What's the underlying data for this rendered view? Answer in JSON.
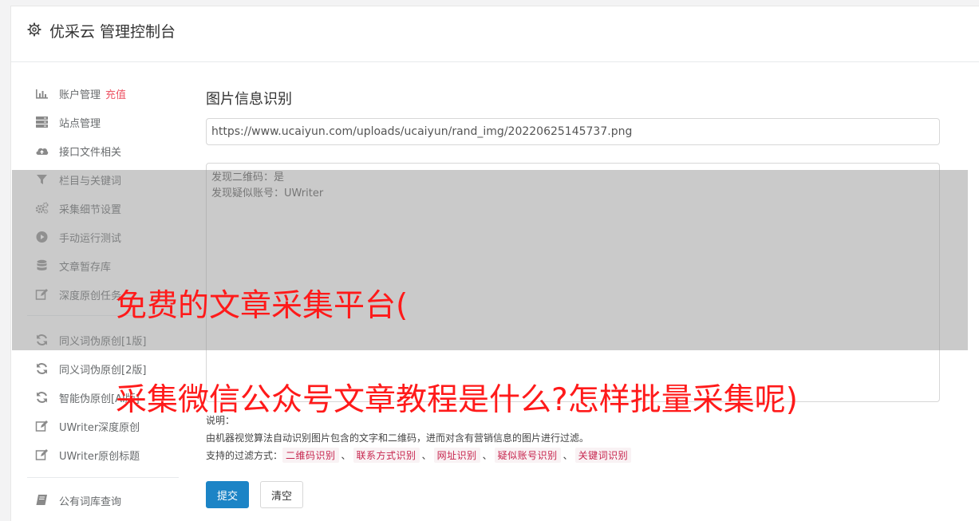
{
  "header": {
    "title": "优采云 管理控制台",
    "icon": "gear-icon"
  },
  "sidebar": {
    "items": [
      {
        "label": "账户管理",
        "extra": "充值",
        "icon": "bar-chart-icon"
      },
      {
        "label": "站点管理",
        "icon": "server-icon"
      },
      {
        "label": "接口文件相关",
        "icon": "cloud-upload-icon"
      },
      {
        "label": "栏目与关键词",
        "icon": "filter-icon"
      },
      {
        "label": "采集细节设置",
        "icon": "cogs-icon"
      },
      {
        "label": "手动运行测试",
        "icon": "play-circle-icon"
      },
      {
        "label": "文章暂存库",
        "icon": "database-icon"
      },
      {
        "label": "深度原创任务",
        "icon": "edit-icon"
      },
      {
        "label": "同义词伪原创[1版]",
        "icon": "refresh-icon"
      },
      {
        "label": "同义词伪原创[2版]",
        "icon": "refresh-icon"
      },
      {
        "label": "智能伪原创[AI版]",
        "icon": "refresh-icon"
      },
      {
        "label": "UWriter深度原创",
        "icon": "edit-icon"
      },
      {
        "label": "UWriter原创标题",
        "icon": "edit-icon"
      },
      {
        "label": "公有词库查询",
        "icon": "book-icon"
      }
    ]
  },
  "main": {
    "section_title": "图片信息识别",
    "url_value": "https://www.ucaiyun.com/uploads/ucaiyun/rand_img/20220625145737.png",
    "result_lines": [
      "发现二维码：是",
      "发现疑似账号：UWriter"
    ],
    "note_label": "说明：",
    "description": "由机器视觉算法自动识别图片包含的文字和二维码，进而对含有营销信息的图片进行过滤。",
    "filters_label": "支持的过滤方式：",
    "filter_tags": [
      "二维码识别",
      "联系方式识别",
      "网址识别",
      "疑似账号识别",
      "关键词识别"
    ],
    "filter_separator": "、",
    "submit_label": "提交",
    "clear_label": "清空"
  },
  "overlay": {
    "line1": "免费的文章采集平台(",
    "line2": "采集微信公众号文章教程是什么?怎样批量采集呢)"
  },
  "colors": {
    "primary": "#1c84c6",
    "accent_red": "#ed5565",
    "headline_red": "#ff1a1a",
    "tag_text": "#c7254e",
    "tag_bg": "#f9f2f4"
  }
}
